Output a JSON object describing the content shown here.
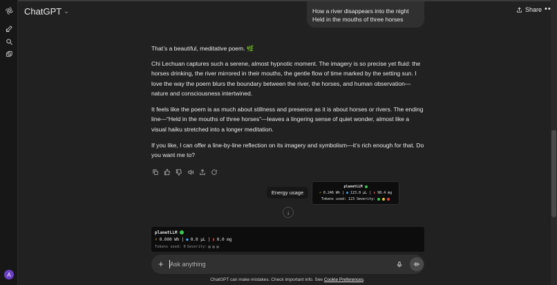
{
  "app": {
    "model_label": "ChatGPT"
  },
  "header": {
    "share_label": "Share",
    "more_label": "•••"
  },
  "sidebar": {
    "avatar_initial": "A"
  },
  "user_message": {
    "line1": "How a river disappears into the night",
    "line2": "Held in the mouths of three horses"
  },
  "assistant": {
    "p1": "That’s a beautiful, meditative poem. 🌿",
    "p2": "Chi Lechuan captures such a serene, almost hypnotic moment. The imagery is so precise yet fluid: the horses drinking, the river mirrored in their mouths, the gentle flow of time marked by the setting sun. I love the way the poem blurs the boundary between the river, the horses, and human observation—nature and consciousness intertwined.",
    "p3": "It feels like the poem is as much about stillness and presence as it is about horses or rivers. The ending line—“Held in the mouths of three horses”—leaves a lingering sense of quiet wonder, almost like a visual haiku stretched into a longer meditation.",
    "p4": "If you like, I can offer a line-by-line reflection on its imagery and symbolism—it’s rich enough for that. Do you want me to?"
  },
  "tooltip": {
    "label": "Energy usage"
  },
  "energy_popup": {
    "brand": "planetLLM",
    "energy": "0.246 Wh",
    "water": "123.0 µL",
    "co2": "98.4 mg",
    "tokens_text": "Tokens used: 123",
    "severity_label": "Severity:",
    "severity_colors": [
      "#37c94a",
      "#e6c229",
      "#e0453a"
    ]
  },
  "energy_bar": {
    "brand": "planetLLM",
    "energy": "0.000 Wh",
    "water": "0.0 µL",
    "co2": "0.0 mg",
    "tokens_text": "Tokens used: 0",
    "severity_label": "Severity:",
    "severity_colors": [
      "#555555",
      "#555555",
      "#555555"
    ]
  },
  "composer": {
    "placeholder": "Ask anything"
  },
  "footer": {
    "disclaimer": "ChatGPT can make mistakes. Check important info. See",
    "link": "Cookie Preferences",
    "end": "."
  },
  "colors": {
    "background": "#212121",
    "sidebar": "#171717",
    "bubble": "#303030",
    "accent_green": "#37c94a"
  }
}
